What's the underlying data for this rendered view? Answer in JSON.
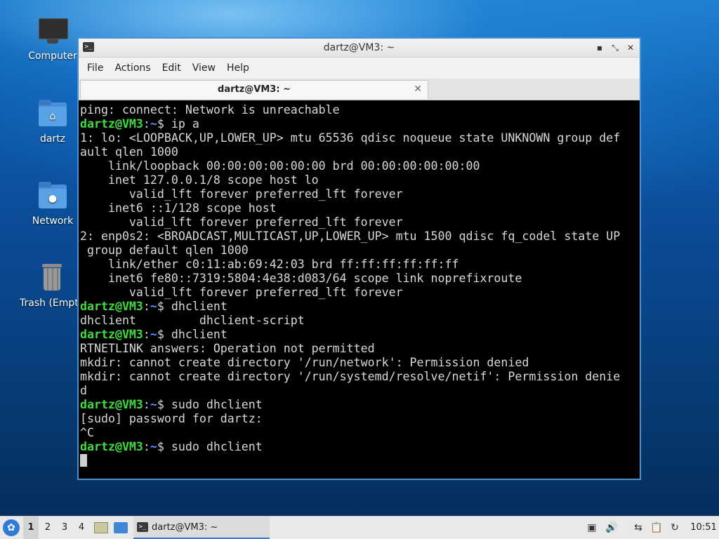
{
  "desktop": {
    "icons": [
      {
        "label": "Computer",
        "icon": "computer-icon"
      },
      {
        "label": "dartz",
        "icon": "home-folder-icon"
      },
      {
        "label": "Network",
        "icon": "network-folder-icon"
      },
      {
        "label": "Trash (Empt",
        "icon": "trash-icon"
      }
    ]
  },
  "window": {
    "title": "dartz@VM3: ~",
    "menu": [
      "File",
      "Actions",
      "Edit",
      "View",
      "Help"
    ],
    "tab_label": "dartz@VM3: ~",
    "controls": {
      "minimize": "▪",
      "maximize": "⤡",
      "close": "✕"
    }
  },
  "terminal": {
    "colors": {
      "user": "#3fdc3f",
      "path": "#5b8fff",
      "text": "#d8d8d8",
      "background": "#000000"
    },
    "prompt": {
      "user": "dartz@VM3",
      "sep": ":",
      "path": "~",
      "sym": "$ "
    },
    "lines": [
      {
        "text": "ping: connect: Network is unreachable"
      },
      {
        "prompt": true,
        "text": "ip a"
      },
      {
        "text": "1: lo: <LOOPBACK,UP,LOWER_UP> mtu 65536 qdisc noqueue state UNKNOWN group def"
      },
      {
        "text": "ault qlen 1000"
      },
      {
        "text": "    link/loopback 00:00:00:00:00:00 brd 00:00:00:00:00:00"
      },
      {
        "text": "    inet 127.0.0.1/8 scope host lo"
      },
      {
        "text": "       valid_lft forever preferred_lft forever"
      },
      {
        "text": "    inet6 ::1/128 scope host"
      },
      {
        "text": "       valid_lft forever preferred_lft forever"
      },
      {
        "text": "2: enp0s2: <BROADCAST,MULTICAST,UP,LOWER_UP> mtu 1500 qdisc fq_codel state UP"
      },
      {
        "text": " group default qlen 1000"
      },
      {
        "text": "    link/ether c0:11:ab:69:42:03 brd ff:ff:ff:ff:ff:ff"
      },
      {
        "text": "    inet6 fe80::7319:5804:4e38:d083/64 scope link noprefixroute"
      },
      {
        "text": "       valid_lft forever preferred_lft forever"
      },
      {
        "prompt": true,
        "text": "dhclient"
      },
      {
        "text": "dhclient         dhclient-script"
      },
      {
        "prompt": true,
        "text": "dhclient"
      },
      {
        "text": "RTNETLINK answers: Operation not permitted"
      },
      {
        "text": "mkdir: cannot create directory '/run/network': Permission denied"
      },
      {
        "text": "mkdir: cannot create directory '/run/systemd/resolve/netif': Permission denie"
      },
      {
        "text": "d"
      },
      {
        "prompt": true,
        "text": "sudo dhclient"
      },
      {
        "text": "[sudo] password for dartz:"
      },
      {
        "text": "^C"
      },
      {
        "prompt": true,
        "text": "sudo dhclient"
      },
      {
        "cursor": true,
        "text": ""
      }
    ]
  },
  "taskbar": {
    "start_icon": "lxqt-start-icon",
    "workspaces": [
      "1",
      "2",
      "3",
      "4"
    ],
    "active_workspace": "1",
    "task_label": "dartz@VM3: ~",
    "clock": "10:51",
    "tray": [
      "screenshot-icon",
      "volume-icon",
      "network-icon",
      "clipboard-icon",
      "update-icon"
    ]
  }
}
